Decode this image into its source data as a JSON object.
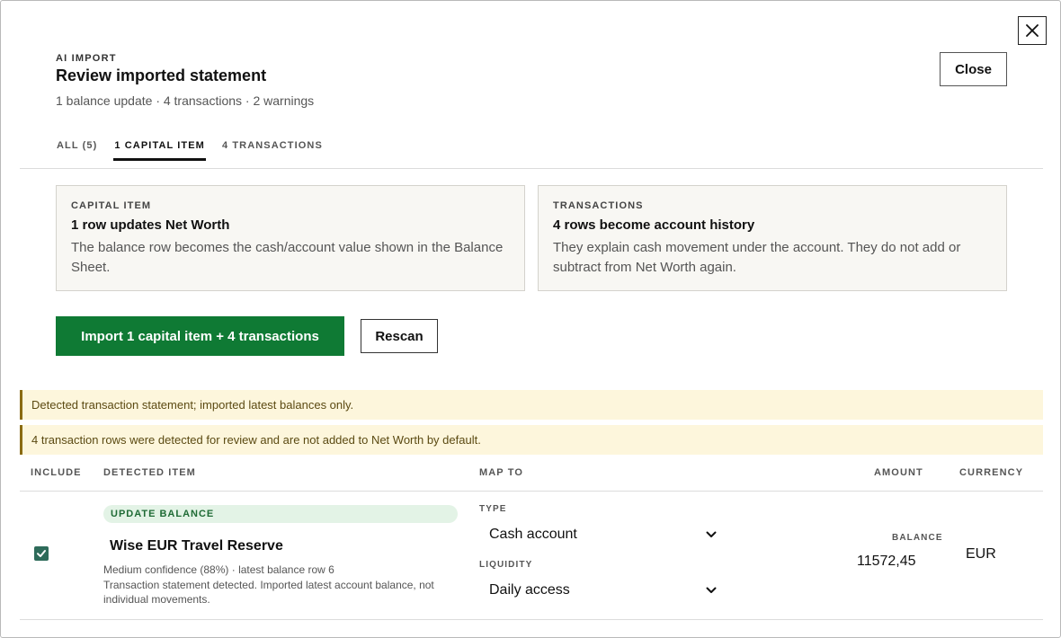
{
  "header": {
    "eyebrow": "AI IMPORT",
    "title": "Review imported statement",
    "subtitle": "1 balance update · 4 transactions · 2 warnings",
    "close_label": "Close"
  },
  "tabs": [
    {
      "label": "ALL (5)",
      "active": false
    },
    {
      "label": "1 CAPITAL ITEM",
      "active": true
    },
    {
      "label": "4 TRANSACTIONS",
      "active": false
    }
  ],
  "cards": [
    {
      "kicker": "CAPITAL ITEM",
      "heading": "1 row updates Net Worth",
      "body": "The balance row becomes the cash/account value shown in the Balance Sheet."
    },
    {
      "kicker": "TRANSACTIONS",
      "heading": "4 rows become account history",
      "body": "They explain cash movement under the account. They do not add or subtract from Net Worth again."
    }
  ],
  "actions": {
    "import_label": "Import 1 capital item + 4 transactions",
    "rescan_label": "Rescan"
  },
  "warnings": [
    "Detected transaction statement; imported latest balances only.",
    "4 transaction rows were detected for review and are not added to Net Worth by default."
  ],
  "table": {
    "headers": [
      "INCLUDE",
      "DETECTED ITEM",
      "MAP TO",
      "AMOUNT",
      "CURRENCY"
    ],
    "row": {
      "included": true,
      "badge": "UPDATE BALANCE",
      "name": "Wise EUR Travel Reserve",
      "meta": "Medium confidence (88%) · latest balance row 6",
      "description": "Transaction statement detected. Imported latest account balance, not individual movements.",
      "type_label": "TYPE",
      "type_value": "Cash account",
      "liquidity_label": "LIQUIDITY",
      "liquidity_value": "Daily access",
      "balance_label": "BALANCE",
      "balance_value": "11572,45",
      "currency": "EUR"
    }
  },
  "colors": {
    "primary": "#0f7a34",
    "warning_bg": "#fdf6dc",
    "warning_border": "#8a6b12",
    "badge_bg": "#e3f3e6",
    "checkbox": "#2e6b5a"
  },
  "icons": {
    "close": "close-icon",
    "checkbox": "check-icon",
    "dropdown": "chevron-down-icon"
  }
}
